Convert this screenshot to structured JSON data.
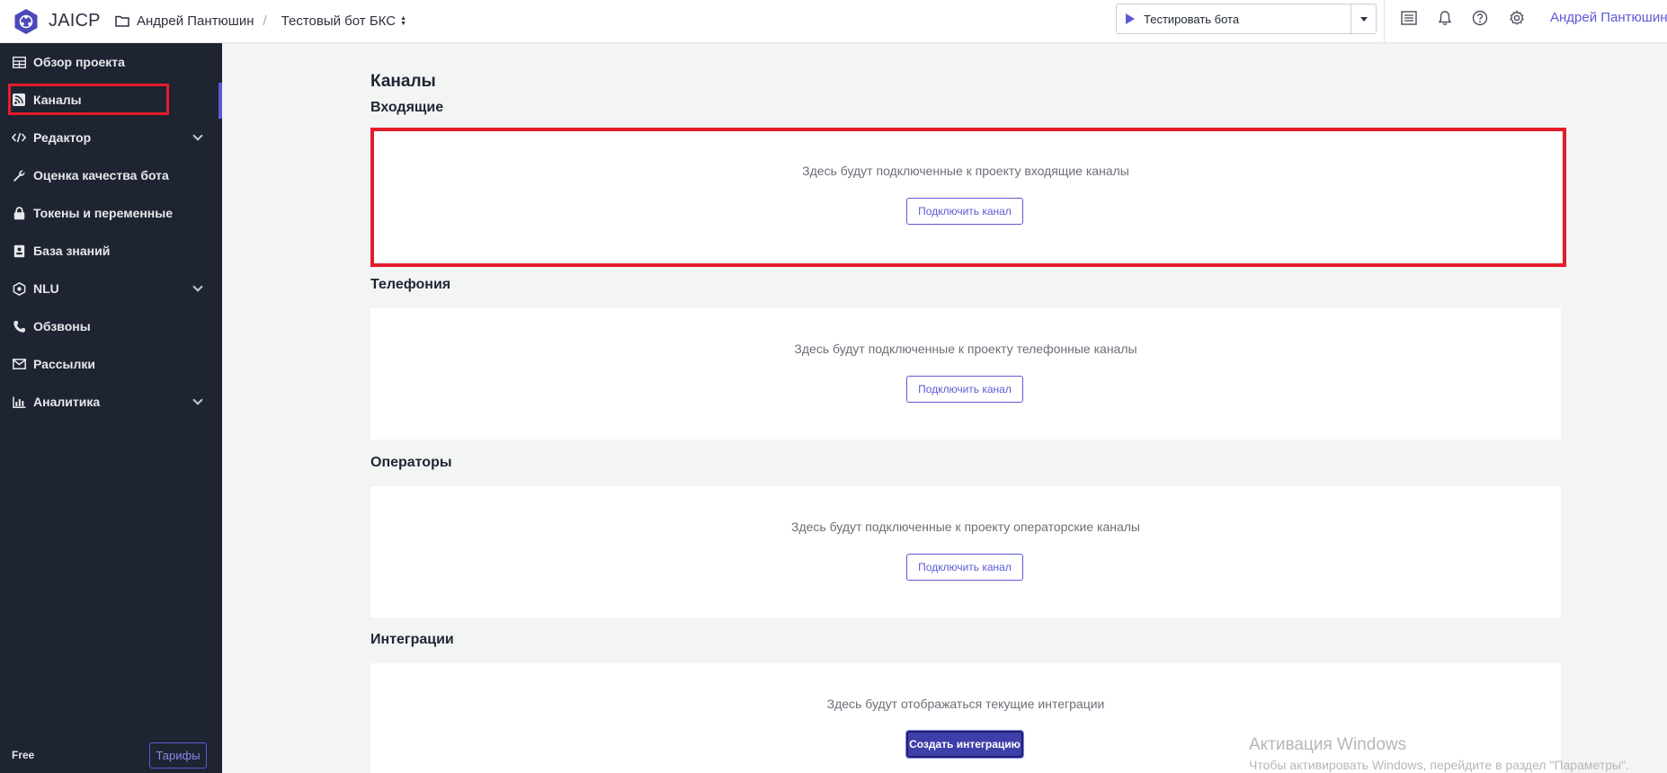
{
  "app": {
    "logo_text": "JAICP"
  },
  "breadcrumb": {
    "owner": "Андрей Пантюшин",
    "separator": "/",
    "project": "Тестовый бот БКС"
  },
  "header": {
    "test_bot_label": "Тестировать бота",
    "user_name": "Андрей Пантюшин"
  },
  "sidebar": {
    "items": [
      {
        "label": "Обзор проекта",
        "icon": "grid-icon"
      },
      {
        "label": "Каналы",
        "icon": "rss-icon",
        "active": true
      },
      {
        "label": "Редактор",
        "icon": "code-icon",
        "expandable": true
      },
      {
        "label": "Оценка качества бота",
        "icon": "wrench-icon"
      },
      {
        "label": "Токены и переменные",
        "icon": "lock-icon"
      },
      {
        "label": "База знаний",
        "icon": "book-icon"
      },
      {
        "label": "NLU",
        "icon": "nlu-icon",
        "expandable": true
      },
      {
        "label": "Обзвоны",
        "icon": "phone-icon"
      },
      {
        "label": "Рассылки",
        "icon": "envelope-icon"
      },
      {
        "label": "Аналитика",
        "icon": "chart-icon",
        "expandable": true
      }
    ],
    "plan": "Free",
    "tariffs_label": "Тарифы"
  },
  "main": {
    "title": "Каналы",
    "sections": [
      {
        "heading": "Входящие",
        "empty_text": "Здесь будут подключенные к проекту входящие каналы",
        "button": "Подключить канал"
      },
      {
        "heading": "Телефония",
        "empty_text": "Здесь будут подключенные к проекту телефонные каналы",
        "button": "Подключить канал"
      },
      {
        "heading": "Операторы",
        "empty_text": "Здесь будут подключенные к проекту операторские каналы",
        "button": "Подключить канал"
      },
      {
        "heading": "Интеграции",
        "empty_text": "Здесь будут отображаться текущие интеграции",
        "button": "Создать интеграцию"
      }
    ]
  },
  "windows_activation": {
    "title": "Активация Windows",
    "subtitle": "Чтобы активировать Windows, перейдите в раздел \"Параметры\"."
  },
  "colors": {
    "accent": "#5d5ad6",
    "sidebar_bg": "#1e2431",
    "highlight": "#e41c2b"
  }
}
